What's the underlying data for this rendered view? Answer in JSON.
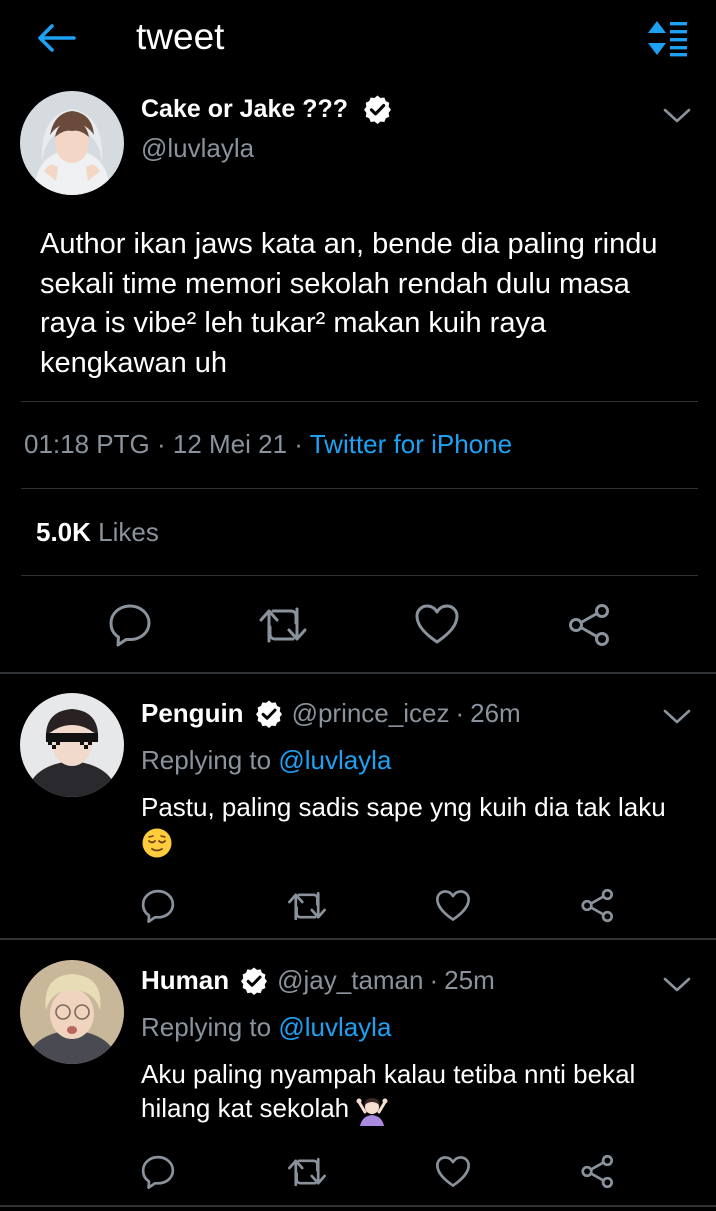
{
  "header": {
    "title": "tweet",
    "back_icon": "back-arrow-icon",
    "sort_icon": "sort-icon",
    "accent_color": "#1da1f2"
  },
  "main_tweet": {
    "name": "Cake or Jake ???",
    "handle": "@luvlayla",
    "verified": true,
    "text": "Author ikan jaws kata an, bende dia paling rindu sekali time memori sekolah rendah dulu masa raya is vibe² leh tukar² makan kuih raya kengkawan uh",
    "time": "01:18 PTG",
    "date": "12 Mei 21",
    "separator": "·",
    "source": "Twitter for iPhone",
    "likes_count": "5.0K",
    "likes_label": "Likes",
    "actions": [
      "reply-icon",
      "retweet-icon",
      "like-icon",
      "share-icon"
    ]
  },
  "replies": [
    {
      "name": "Penguin",
      "handle": "@prince_icez",
      "dot": "·",
      "time": "26m",
      "replying_prefix": "Replying to",
      "replying_to": "@luvlayla",
      "text": "Pastu, paling sadis sape yng kuih dia tak laku",
      "emoji": "relieved-face-emoji"
    },
    {
      "name": "Human",
      "handle": "@jay_taman",
      "dot": "·",
      "time": "25m",
      "replying_prefix": "Replying to",
      "replying_to": "@luvlayla",
      "text": "Aku paling nyampah kalau tetiba nnti bekal hilang kat sekolah",
      "emoji": "person-gesturing-emoji"
    }
  ],
  "colors": {
    "background": "#000000",
    "text": "#ffffff",
    "secondary_text": "#8a939c",
    "link": "#1da1f2",
    "divider": "#2f3336"
  }
}
